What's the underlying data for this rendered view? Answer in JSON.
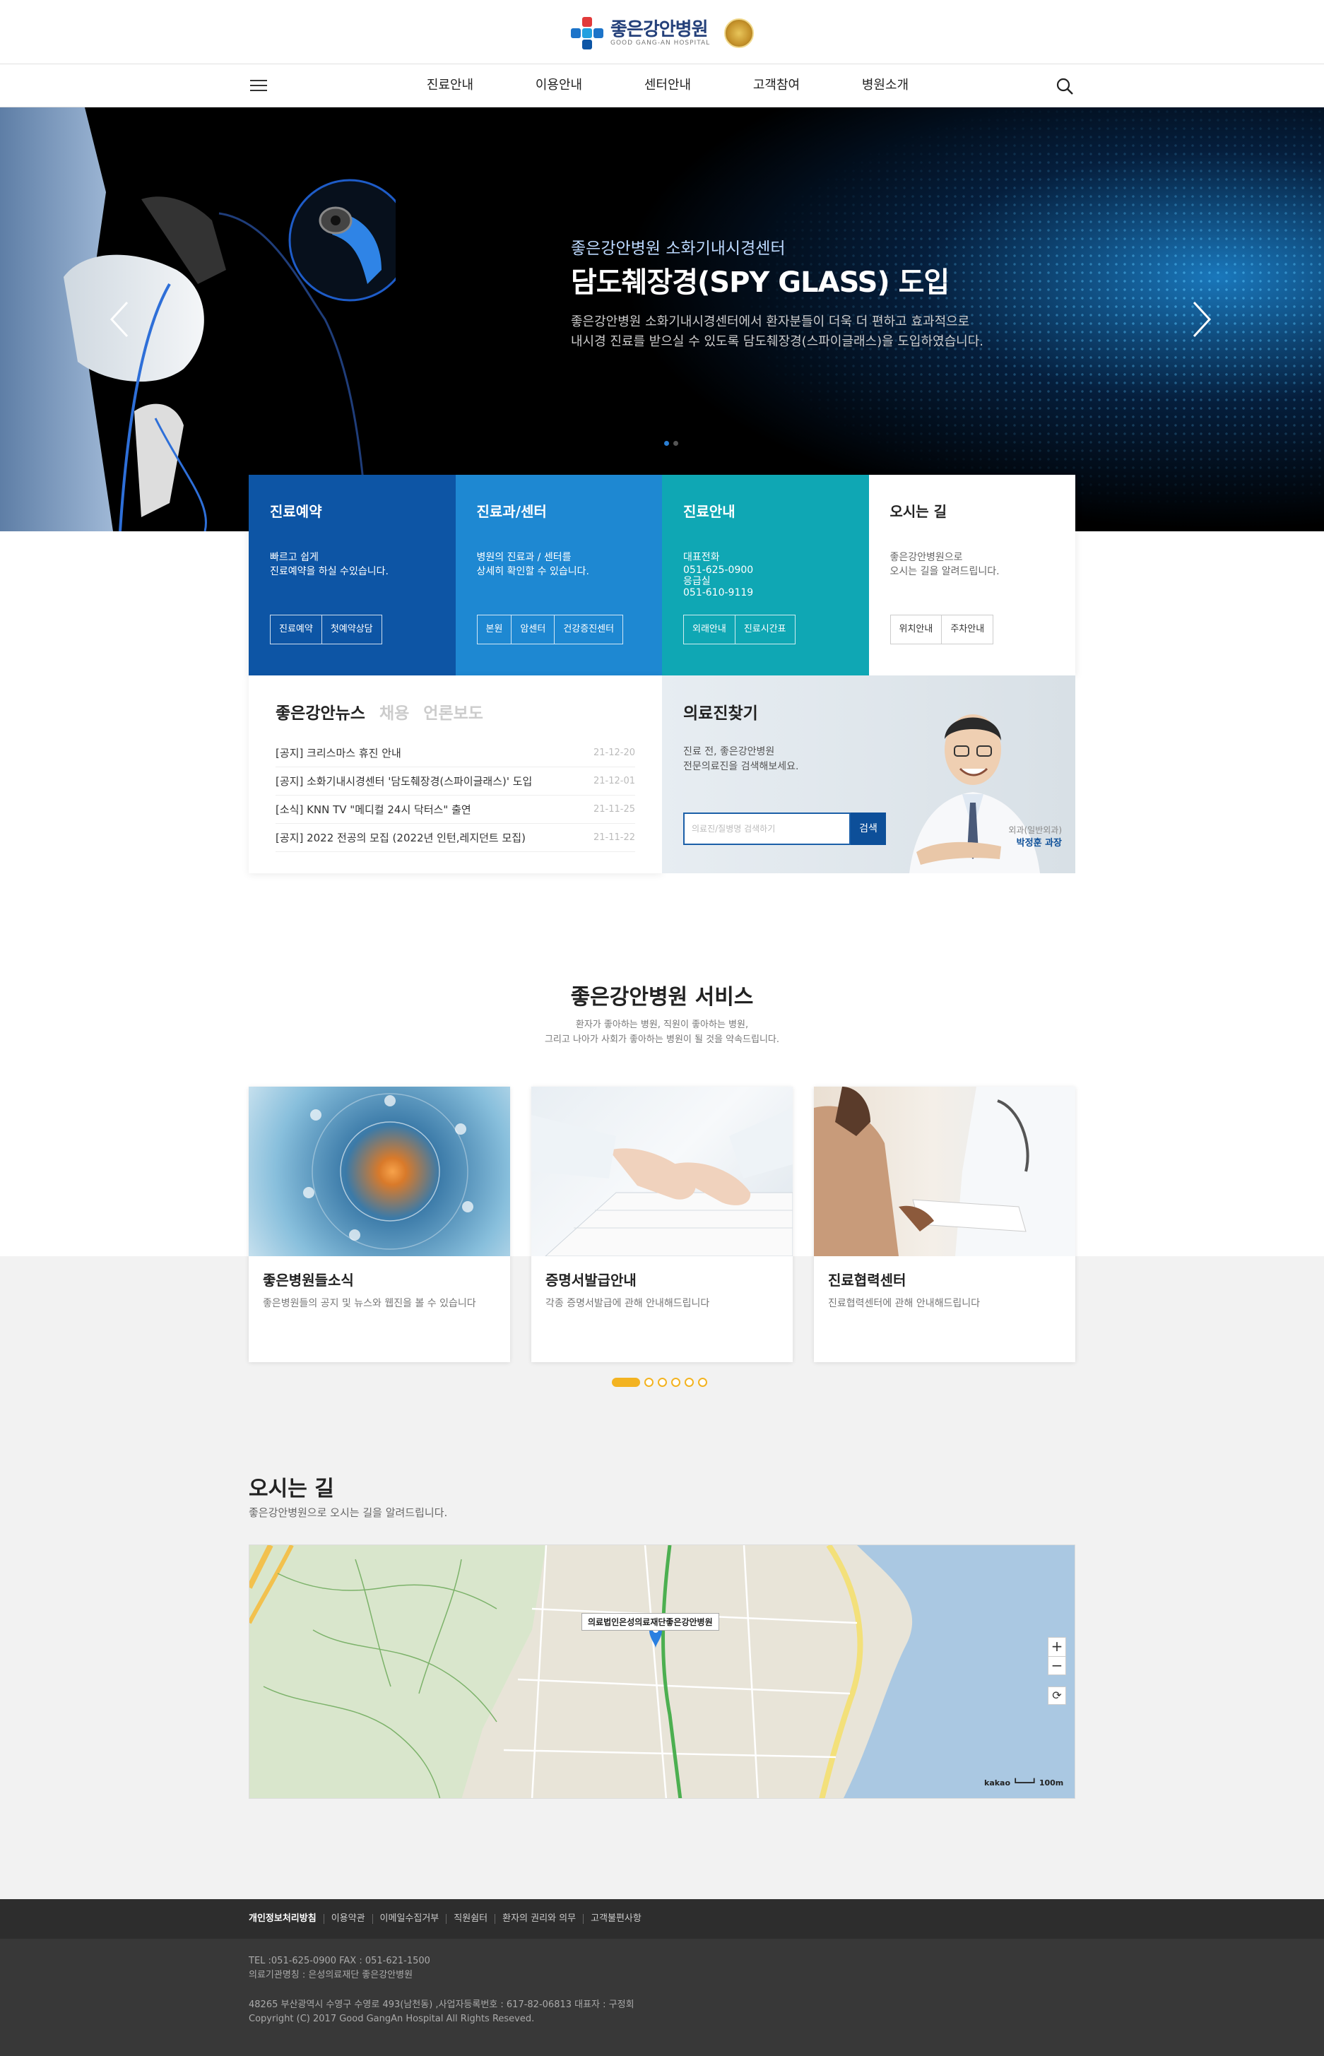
{
  "header": {
    "logo_ko": "좋은강안병원",
    "logo_en": "GOOD GANG-AN HOSPITAL",
    "nav": [
      "진료안내",
      "이용안내",
      "센터안내",
      "고객참여",
      "병원소개"
    ]
  },
  "hero": {
    "subtitle": "좋은강안병원 소화기내시경센터",
    "title": "담도췌장경(SPY GLASS) 도입",
    "desc_line1": "좋은강안병원 소화기내시경센터에서 환자분들이 더욱 더 편하고 효과적으로",
    "desc_line2": "내시경 진료를 받으실 수 있도록 담도췌장경(스파이글래스)을 도입하였습니다."
  },
  "quick": [
    {
      "title": "진료예약",
      "line1": "빠르고 쉽게",
      "line2": "진료예약을 하실 수있습니다.",
      "buttons": [
        "진료예약",
        "첫예약상담"
      ]
    },
    {
      "title": "진료과/센터",
      "line1": "병원의 진료과 / 센터를",
      "line2": "상세히 확인할 수 있습니다.",
      "buttons": [
        "본원",
        "암센터",
        "건강증진센터"
      ]
    },
    {
      "title": "진료안내",
      "line1": "대표전화",
      "line2": "051-625-0900",
      "line3": "응급실",
      "line4": "051-610-9119",
      "buttons": [
        "외래안내",
        "진료시간표"
      ]
    },
    {
      "title": "오시는 길",
      "line1": "좋은강안병원으로",
      "line2": "오시는 길을 알려드립니다.",
      "buttons": [
        "위치안내",
        "주차안내"
      ]
    }
  ],
  "news": {
    "tabs": [
      "좋은강안뉴스",
      "채용",
      "언론보도"
    ],
    "items": [
      {
        "title": "[공지] 크리스마스 휴진 안내",
        "date": "21-12-20"
      },
      {
        "title": "[공지] 소화기내시경센터 '담도췌장경(스파이글래스)' 도입",
        "date": "21-12-01"
      },
      {
        "title": "[소식] KNN TV \"메디컬 24시 닥터스\" 출연",
        "date": "21-11-25"
      },
      {
        "title": "[공지] 2022 전공의 모집 (2022년 인턴,레지던트 모집)",
        "date": "21-11-22"
      }
    ]
  },
  "doctor": {
    "title": "의료진찾기",
    "line1": "진료 전, 좋은강안병원",
    "line2": "전문의료진을 검색해보세요.",
    "placeholder": "의료진/질병명 검색하기",
    "search_btn": "검색",
    "dept": "외과(일반외과)",
    "name": "박정훈 과장"
  },
  "services": {
    "title": "좋은강안병원 서비스",
    "desc1": "환자가 좋아하는 병원, 직원이 좋아하는 병원,",
    "desc2": "그리고 나아가 사회가 좋아하는 병원이 될 것을 약속드립니다.",
    "cards": [
      {
        "title": "좋은병원들소식",
        "desc": "좋은병원들의 공지 및 뉴스와 웹진을 볼 수 있습니다"
      },
      {
        "title": "증명서발급안내",
        "desc": "각종 증명서발급에 관해 안내해드립니다"
      },
      {
        "title": "진료협력센터",
        "desc": "진료협력센터에 관해 안내해드립니다"
      }
    ]
  },
  "location": {
    "title": "오시는 길",
    "desc": "좋은강안병원으로 오시는 길을 알려드립니다.",
    "map_label": "의료법인은성의료재단좋은강안병원",
    "kakao": "kakao",
    "scale": "100m"
  },
  "footer": {
    "links": [
      "개인정보처리방침",
      "이용약관",
      "이메일수집거부",
      "직원쉼터",
      "환자의 권리와 의무",
      "고객불편사항"
    ],
    "tel": "TEL :051-625-0900 FAX : 051-621-1500",
    "org": "의료기관명칭 : 은성의료재단 좋은강안병원",
    "addr": "48265 부산광역시 수영구 수영로 493(남천동) ,사업자등록번호 : 617-82-06813 대표자 : 구정회",
    "copy": "Copyright (C) 2017 Good GangAn Hospital All Rights Reseved."
  },
  "colors": {
    "primary": "#0d55a5",
    "secondary": "#1e88d2",
    "teal": "#0fa7b4",
    "accent": "#f3b321"
  }
}
